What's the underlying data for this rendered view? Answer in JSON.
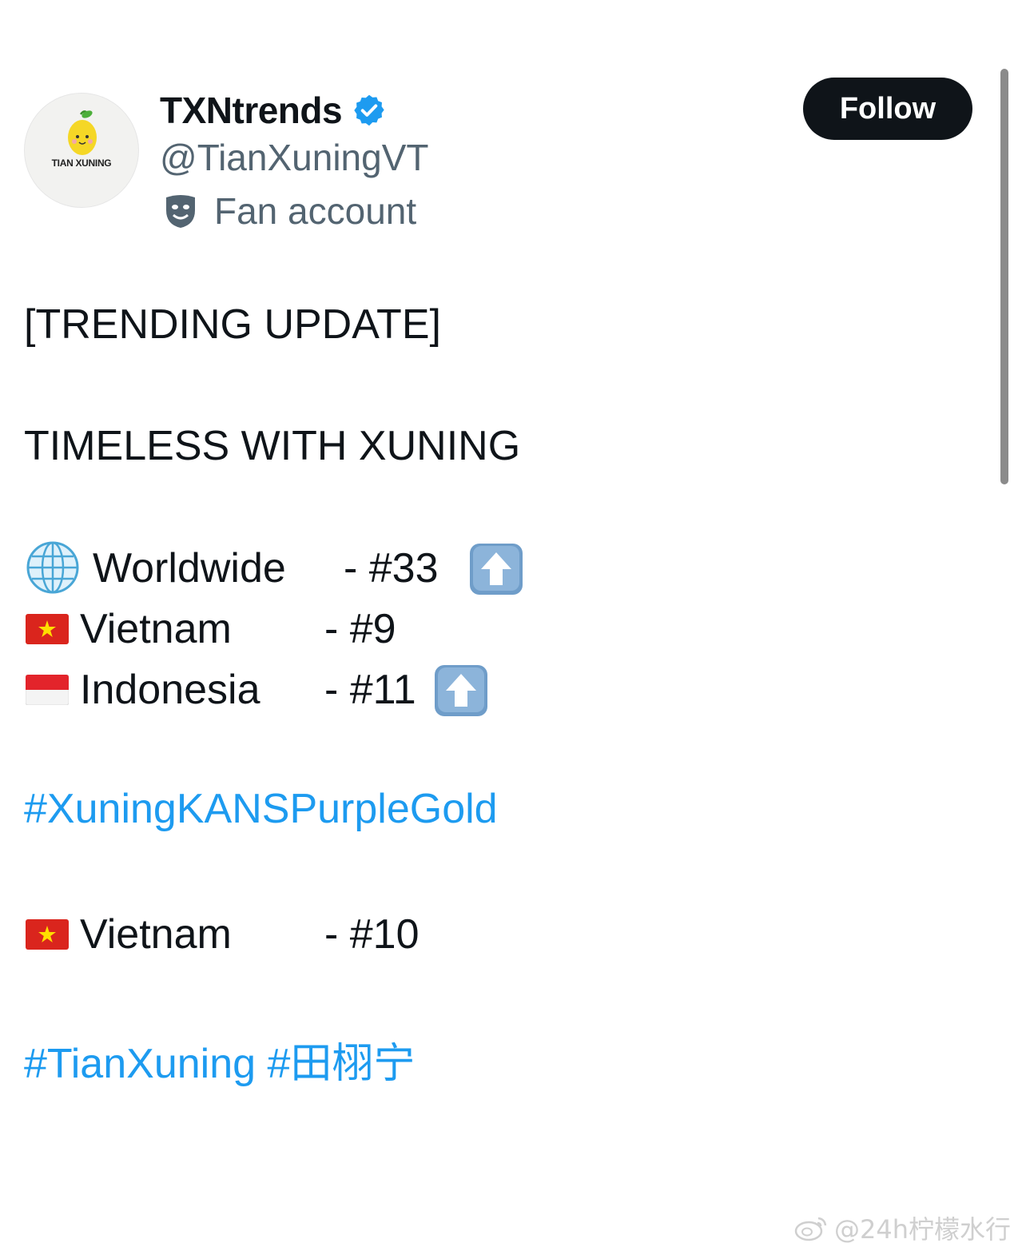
{
  "profile": {
    "avatar_text": "TIAN XUNING",
    "display_name": "TXNtrends",
    "verified_icon": "verified-badge-icon",
    "handle": "@TianXuningVT",
    "label_icon": "theater-masks-icon",
    "label": "Fan account",
    "follow_label": "Follow"
  },
  "tweet": {
    "heading": "[TRENDING UPDATE]",
    "subject": "TIMELESS WITH XUNING",
    "rankings": [
      {
        "icon": "globe-icon",
        "country": "Worldwide",
        "rank": "- #33",
        "trend_icon": "up-arrow-icon"
      },
      {
        "icon": "vietnam-flag-icon",
        "country": "Vietnam",
        "rank": "- #9",
        "trend_icon": ""
      },
      {
        "icon": "indonesia-flag-icon",
        "country": "Indonesia",
        "rank": "- #11",
        "trend_icon": "up-arrow-icon"
      }
    ],
    "hashtag1": "#XuningKANSPurpleGold",
    "ranking2": {
      "icon": "vietnam-flag-icon",
      "country": "Vietnam",
      "rank": "- #10"
    },
    "hashtag2": "#TianXuning #田栩宁"
  },
  "watermark": "@24h柠檬水行",
  "colors": {
    "link": "#1d9bf0",
    "verified": "#1d9bf0",
    "follow_bg": "#0f1419",
    "text": "#0f1419",
    "muted": "#536471"
  }
}
